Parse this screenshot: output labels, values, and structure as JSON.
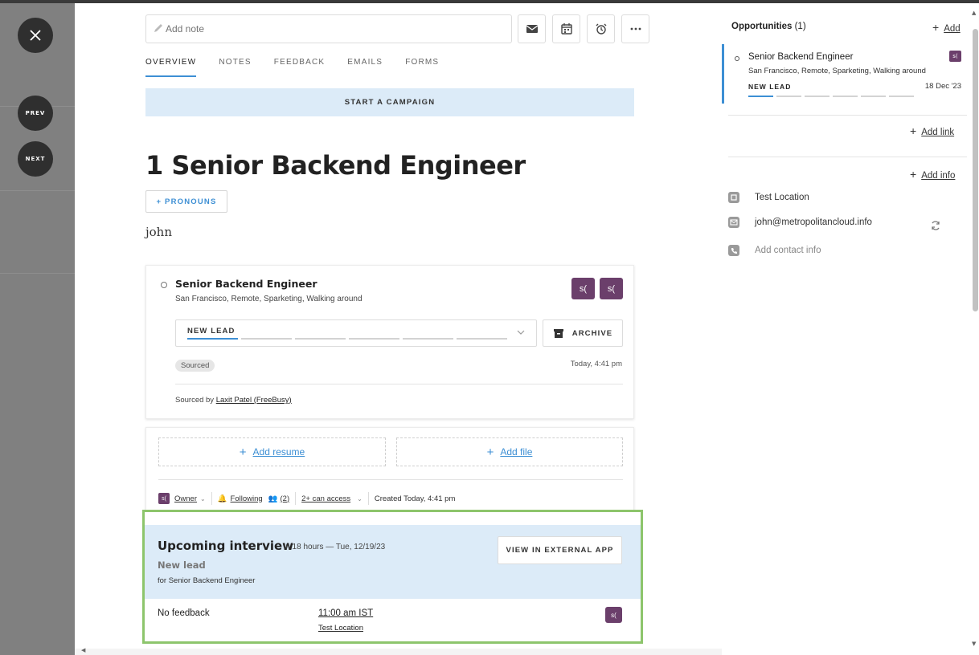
{
  "overlay": {
    "prev_label": "PREV",
    "next_label": "NEXT"
  },
  "toolbar": {
    "note_placeholder": "Add note",
    "icons": [
      "email-icon",
      "calendar-icon",
      "alarm-clock-icon",
      "more-icon"
    ]
  },
  "tabs": [
    {
      "label": "OVERVIEW",
      "active": true
    },
    {
      "label": "NOTES",
      "active": false
    },
    {
      "label": "FEEDBACK",
      "active": false
    },
    {
      "label": "EMAILS",
      "active": false
    },
    {
      "label": "FORMS",
      "active": false
    }
  ],
  "campaign_label": "START A CAMPAIGN",
  "profile": {
    "title": "1 Senior Backend Engineer",
    "pronouns_label": "+ PRONOUNS",
    "name": "john"
  },
  "opportunity": {
    "title": "Senior Backend Engineer",
    "location": "San Francisco, Remote, Sparketing, Walking around",
    "avatars": [
      "s(",
      "s("
    ],
    "stage": "NEW LEAD",
    "stage_step": 1,
    "stage_count": 6,
    "archive_label": "ARCHIVE",
    "source_badge": "Sourced",
    "timestamp": "Today, 4:41 pm",
    "sourced_by_prefix": "Sourced by",
    "sourced_by_name": "Laxit Patel (FreeBusy)"
  },
  "files": {
    "add_resume": "Add resume",
    "add_file": "Add file",
    "owner_label": "Owner",
    "following_label": "Following",
    "followers_count": "(2)",
    "access_label": "2+ can access",
    "created": "Created Today, 4:41 pm",
    "avatar_text": "s("
  },
  "interview": {
    "title": "Upcoming interview",
    "when": "in 18 hours — Tue, 12/19/23",
    "stage": "New lead",
    "for": "for Senior Backend Engineer",
    "button": "VIEW IN EXTERNAL APP",
    "feedback": "No feedback",
    "time": "11:00 am IST",
    "location": "Test Location",
    "avatar_text": "s("
  },
  "sidebar": {
    "opportunities_label": "Opportunities",
    "opportunities_count": "(1)",
    "add_label": "Add",
    "opp": {
      "title": "Senior Backend Engineer",
      "location": "San Francisco, Remote, Sparketing, Walking around",
      "stage": "NEW LEAD",
      "date": "18 Dec '23",
      "avatar_text": "s("
    },
    "add_link_label": "Add link",
    "add_info_label": "Add info",
    "location": "Test Location",
    "email": "john@metropolitancloud.info",
    "add_contact": "Add contact info"
  },
  "colors": {
    "accent": "#3d8fd4",
    "highlight_border": "#8dc56c",
    "avatar": "#6b3f6b",
    "banner": "#dcebf8"
  }
}
